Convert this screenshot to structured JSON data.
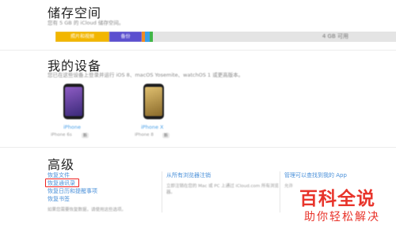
{
  "storage": {
    "title": "储存空间",
    "subtitle": "您有 5 GB 的 iCloud 储存空间。",
    "segments": [
      {
        "label": "照片和视频",
        "color": "#f2b600"
      },
      {
        "label": "备份",
        "color": "#5b4fcf"
      }
    ],
    "small_colors": [
      "#f08a24",
      "#3aa0e8",
      "#41b649"
    ],
    "available": "4 GB 可用"
  },
  "devices": {
    "title": "我的设备",
    "subtitle": "您已在这些设备上登录并运行 iOS 8、macOS Yosemite、watchOS 1 或更高版本。",
    "items": [
      {
        "name": "iPhone",
        "meta": "iPhone 6s",
        "badge": "新",
        "screen": "#7a4fb0"
      },
      {
        "name": "iPhone X",
        "meta": "iPhone 8",
        "badge": "新",
        "screen": "#c9a24a"
      }
    ]
  },
  "advanced": {
    "title": "高级",
    "col1": {
      "links": [
        "恢复文件",
        "恢复通讯录",
        "恢复日历和提醒事项",
        "恢复书签"
      ],
      "note": "如果您需要恢复数据，请使用这些选项。"
    },
    "col2": {
      "link": "从所有浏览器注销",
      "note": "立即注销在您的 Mac 或 PC 上通过 iCloud.com 所有浏览器。"
    },
    "col3": {
      "link": "管理可以查找到我的 App",
      "note": "允许"
    }
  },
  "watermark": {
    "line1": "百科全说",
    "line2": "助你轻松解决"
  }
}
